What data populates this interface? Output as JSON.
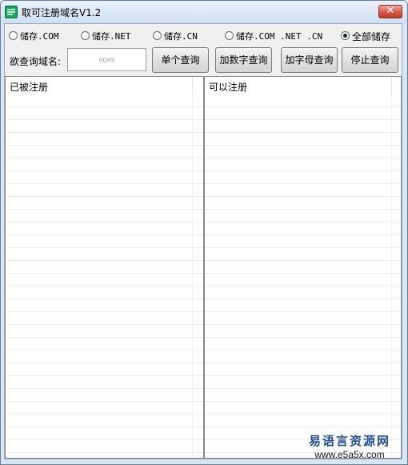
{
  "window": {
    "title": "取可注册域名V1.2",
    "close_glyph": "✕"
  },
  "radios": [
    {
      "label": "储存.COM",
      "checked": false
    },
    {
      "label": "储存.NET",
      "checked": false
    },
    {
      "label": "储存.CN",
      "checked": false
    },
    {
      "label": "储存.COM .NET .CN",
      "checked": false
    },
    {
      "label": "全部储存",
      "checked": true
    }
  ],
  "query": {
    "label": "欲查询域名:",
    "value": "qqes"
  },
  "buttons": {
    "single": "单个查询",
    "add_digits": "加数字查询",
    "add_letters": "加字母查询",
    "stop": "停止查询"
  },
  "lists": {
    "registered_header": "已被注册",
    "available_header": "可以注册"
  },
  "watermark": {
    "brand": "易语言资源网",
    "url": "www.e5a5x.com"
  },
  "colors": {
    "titlebar": "#d7e5f5",
    "close": "#c9462f",
    "accent_text": "#1f4f8f",
    "app_icon": "#18a35f"
  }
}
